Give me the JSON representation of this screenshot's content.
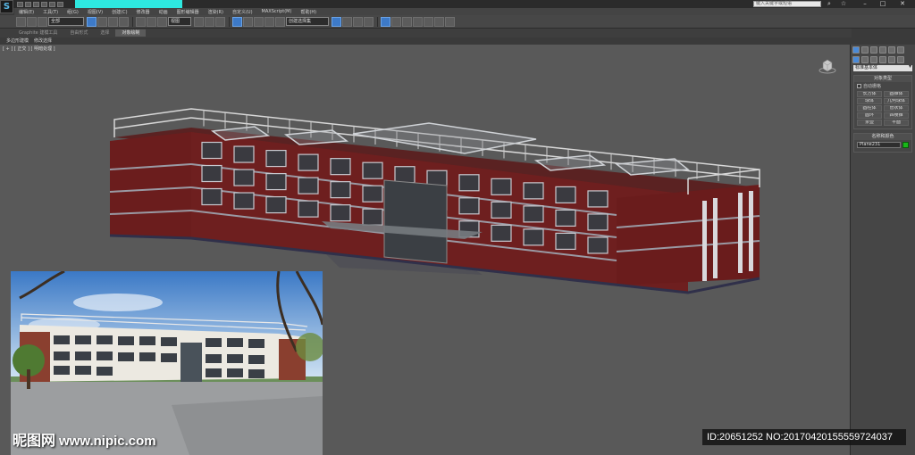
{
  "app": {
    "logo_glyph": "S",
    "search_placeholder": "键入关键字或短语"
  },
  "menubar": {
    "items": [
      "编辑(E)",
      "工具(T)",
      "组(G)",
      "视图(V)",
      "创建(C)",
      "修改器",
      "动画",
      "图形编辑器",
      "渲染(R)",
      "自定义(U)",
      "MAXScript(M)",
      "帮助(H)"
    ]
  },
  "toolbar": {
    "selection_filter": "全部",
    "ref_coord": "视图",
    "named_selection": "创建选择集"
  },
  "ribbon": {
    "tabs": [
      "Graphite 建模工具",
      "自由形式",
      "选择",
      "对象绘制"
    ],
    "active_index": 3
  },
  "subribbon": {
    "items": [
      "多边形建模",
      "修改选择"
    ]
  },
  "viewport": {
    "label": "[ + ] [ 正交 ] [ 明暗处理 ]"
  },
  "watermark": {
    "cn": "昵图网",
    "site": "www.nipic.com"
  },
  "command_panel": {
    "dropdown": "标准基本体",
    "object_type_title": "对象类型",
    "autogrid_label": "自动栅格",
    "buttons": [
      "长方体",
      "圆锥体",
      "球体",
      "几何球体",
      "圆柱体",
      "管状体",
      "圆环",
      "四棱锥",
      "茶壶",
      "平面"
    ],
    "name_color_title": "名称和颜色",
    "object_name": "Plane231"
  },
  "footer_id": "ID:20651252 NO:20170420155559724037",
  "colors": {
    "accent_title": "#2ee8e0",
    "swatch": "#18b818",
    "brick": "#6b1d1d"
  }
}
